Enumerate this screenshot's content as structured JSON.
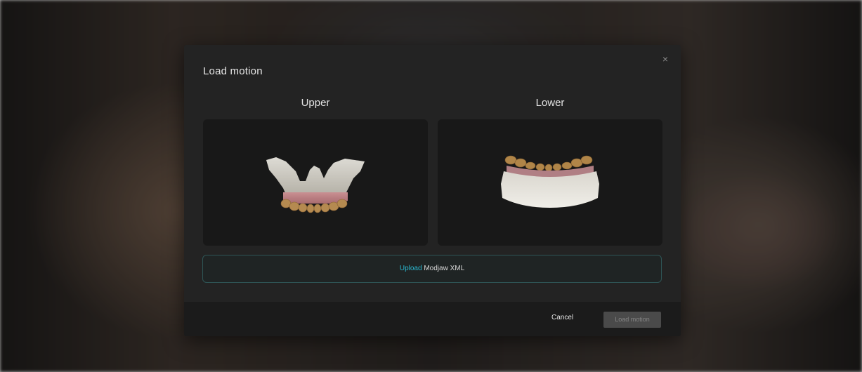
{
  "dialog": {
    "title": "Load motion",
    "close_icon": "close-icon",
    "close_glyph": "×"
  },
  "upper": {
    "label": "Upper",
    "preview": "upper-jaw-3d-model"
  },
  "lower": {
    "label": "Lower",
    "preview": "lower-jaw-3d-model"
  },
  "upload": {
    "link_text": "Upload",
    "rest_text": " Modjaw XML"
  },
  "footer": {
    "cancel_label": "Cancel",
    "load_label": "Load motion",
    "load_disabled": true
  },
  "colors": {
    "accent": "#2ab8d0",
    "dialog_bg": "#232323",
    "panel_bg": "#181818"
  }
}
